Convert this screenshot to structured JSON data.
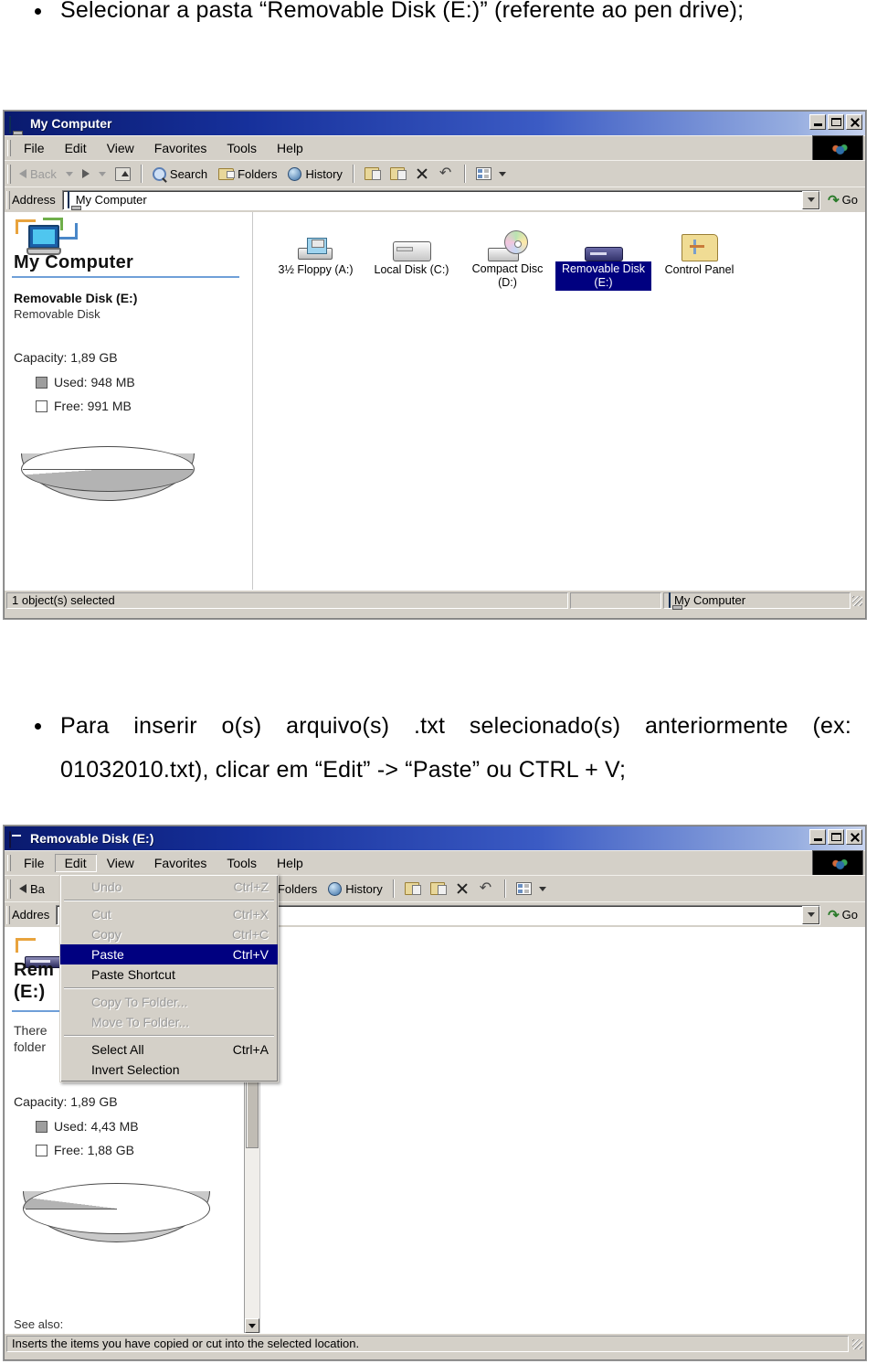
{
  "document": {
    "bullet1": "Selecionar a pasta “Removable Disk (E:)” (referente ao pen drive);",
    "bullet2": "Para inserir o(s) arquivo(s) .txt selecionado(s) anteriormente (ex: 01032010.txt), clicar em “Edit” -> “Paste” ou CTRL + V;"
  },
  "colors": {
    "title_blue": "#16309b",
    "selection_blue": "#000080",
    "window_face": "#d4d0c8",
    "accent_rule": "#6f9fd8"
  },
  "window1": {
    "title": "My Computer",
    "title_icon": "my-computer-icon",
    "window_buttons": {
      "minimize": "_",
      "maximize": "□",
      "close": "✕"
    },
    "menu": [
      "File",
      "Edit",
      "View",
      "Favorites",
      "Tools",
      "Help"
    ],
    "toolbar": {
      "back": "Back",
      "forward": "",
      "up": "",
      "search": "Search",
      "folders": "Folders",
      "history": "History",
      "move_to": "",
      "copy_to": "",
      "delete": "",
      "undo": "",
      "views": ""
    },
    "address": {
      "label": "Address",
      "value": "My Computer",
      "go": "Go"
    },
    "left_pane": {
      "heading": "My Computer",
      "item_name": "Removable Disk (E:)",
      "item_type": "Removable Disk",
      "capacity": "Capacity: 1,89 GB",
      "used": "Used: 948 MB",
      "free": "Free: 991 MB",
      "used_fraction": 0.49
    },
    "items": [
      {
        "label": "3½ Floppy (A:)",
        "icon": "floppy-drive-icon",
        "selected": false
      },
      {
        "label": "Local Disk (C:)",
        "icon": "hard-disk-icon",
        "selected": false
      },
      {
        "label": "Compact Disc (D:)",
        "icon": "cd-drive-icon",
        "selected": false
      },
      {
        "label": "Removable Disk (E:)",
        "icon": "usb-drive-icon",
        "selected": true
      },
      {
        "label": "Control Panel",
        "icon": "control-panel-icon",
        "selected": false
      }
    ],
    "statusbar": {
      "left": "1 object(s) selected",
      "middle": "",
      "right": "My Computer"
    }
  },
  "window2": {
    "title": "Removable Disk (E:)",
    "title_icon": "removable-disk-icon",
    "window_buttons": {
      "minimize": "_",
      "maximize": "□",
      "close": "✕"
    },
    "menu": [
      "File",
      "Edit",
      "View",
      "Favorites",
      "Tools",
      "Help"
    ],
    "toolbar": {
      "back": "Ba",
      "folders": "Folders",
      "history": "History"
    },
    "address": {
      "label": "Addres",
      "value": "",
      "go": "Go"
    },
    "edit_menu": {
      "open_on": "Edit",
      "items": [
        {
          "label": "Undo",
          "accel": "Ctrl+Z",
          "state": "disabled"
        },
        {
          "label": "-",
          "accel": "",
          "state": "separator"
        },
        {
          "label": "Cut",
          "accel": "Ctrl+X",
          "state": "disabled"
        },
        {
          "label": "Copy",
          "accel": "Ctrl+C",
          "state": "disabled"
        },
        {
          "label": "Paste",
          "accel": "Ctrl+V",
          "state": "selected"
        },
        {
          "label": "Paste Shortcut",
          "accel": "",
          "state": "enabled"
        },
        {
          "label": "-",
          "accel": "",
          "state": "separator"
        },
        {
          "label": "Copy To Folder...",
          "accel": "",
          "state": "disabled"
        },
        {
          "label": "Move To Folder...",
          "accel": "",
          "state": "disabled"
        },
        {
          "label": "-",
          "accel": "",
          "state": "separator"
        },
        {
          "label": "Select All",
          "accel": "Ctrl+A",
          "state": "enabled"
        },
        {
          "label": "Invert Selection",
          "accel": "",
          "state": "enabled"
        }
      ]
    },
    "left_pane": {
      "heading_line1": "Rem",
      "heading_line2": "(E:)",
      "desc_line1": "There",
      "desc_line2": "folder",
      "capacity": "Capacity: 1,89 GB",
      "used": "Used: 4,43 MB",
      "free": "Free: 1,88 GB",
      "used_fraction": 0.02,
      "see_also": "See also:"
    },
    "statusbar": {
      "left": "Inserts the items you have copied or cut into the selected location."
    }
  }
}
